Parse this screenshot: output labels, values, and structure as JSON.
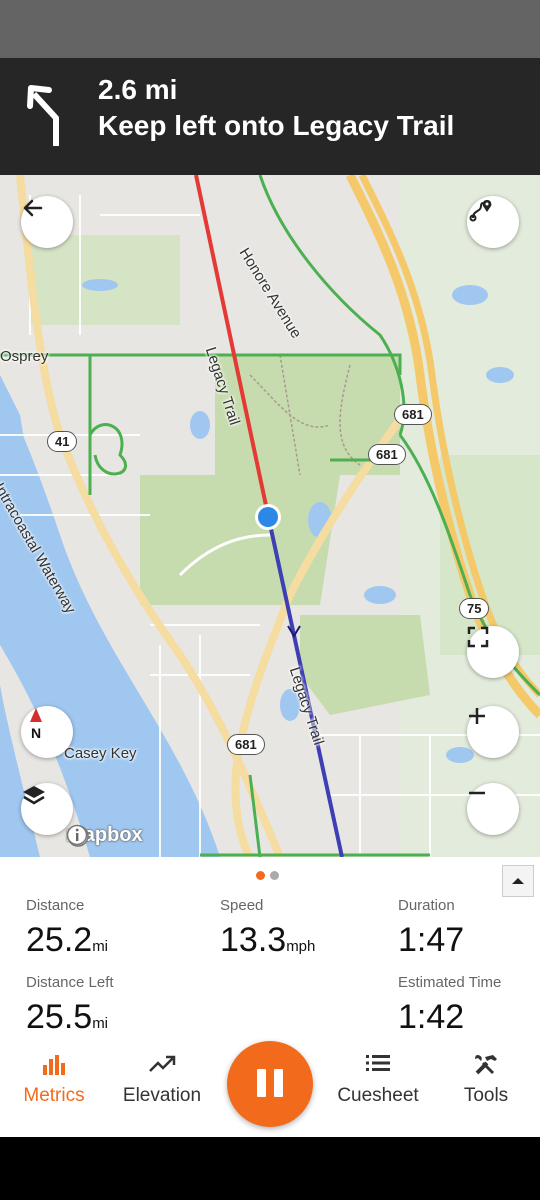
{
  "navigation": {
    "distance": "2.6 mi",
    "instruction": "Keep left onto Legacy Trail",
    "turn_icon": "keep-left-arrow-icon"
  },
  "map": {
    "labels": {
      "osprey": "Osprey",
      "honore_avenue": "Honore Avenue",
      "legacy_trail_north": "Legacy Trail",
      "legacy_trail_south": "Legacy Trail",
      "intracoastal": "Intracoastal Waterway",
      "casey_key": "Casey Key"
    },
    "shields": {
      "r41": "41",
      "r681_a": "681",
      "r681_b": "681",
      "r681_c": "681",
      "r75": "75"
    },
    "attribution": "mapbox",
    "compass_label": "N",
    "colors": {
      "route_done": "#e53935",
      "route_ahead": "#3f3fb5",
      "position": "#2c87e6",
      "water": "#9fc7f0",
      "park": "#c7dcae",
      "highway": "#f5c86a"
    }
  },
  "metrics": {
    "distance": {
      "label": "Distance",
      "value": "25.2",
      "unit": "mi"
    },
    "speed": {
      "label": "Speed",
      "value": "13.3",
      "unit": "mph"
    },
    "duration": {
      "label": "Duration",
      "value": "1:47"
    },
    "distance_left": {
      "label": "Distance Left",
      "value": "25.5",
      "unit": "mi"
    },
    "estimated_time": {
      "label": "Estimated Time",
      "value": "1:42"
    }
  },
  "page_indicator": {
    "count": 2,
    "active": 1
  },
  "tabs": {
    "metrics": "Metrics",
    "elevation": "Elevation",
    "cuesheet": "Cuesheet",
    "tools": "Tools",
    "active_color": "#f26b1d"
  }
}
